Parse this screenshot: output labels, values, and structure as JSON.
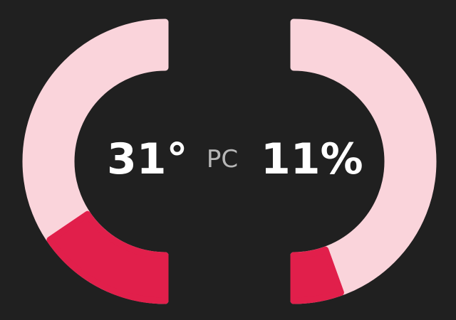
{
  "device": {
    "label": "PC"
  },
  "temperature": {
    "display": "31°",
    "fill_fraction": 0.31
  },
  "load": {
    "display": "11%",
    "fill_fraction": 0.11
  },
  "colors": {
    "background": "#202020",
    "track": "#fad4db",
    "fill": "#e11f4b",
    "text_primary": "#ffffff",
    "text_secondary": "#b7b7b7"
  }
}
